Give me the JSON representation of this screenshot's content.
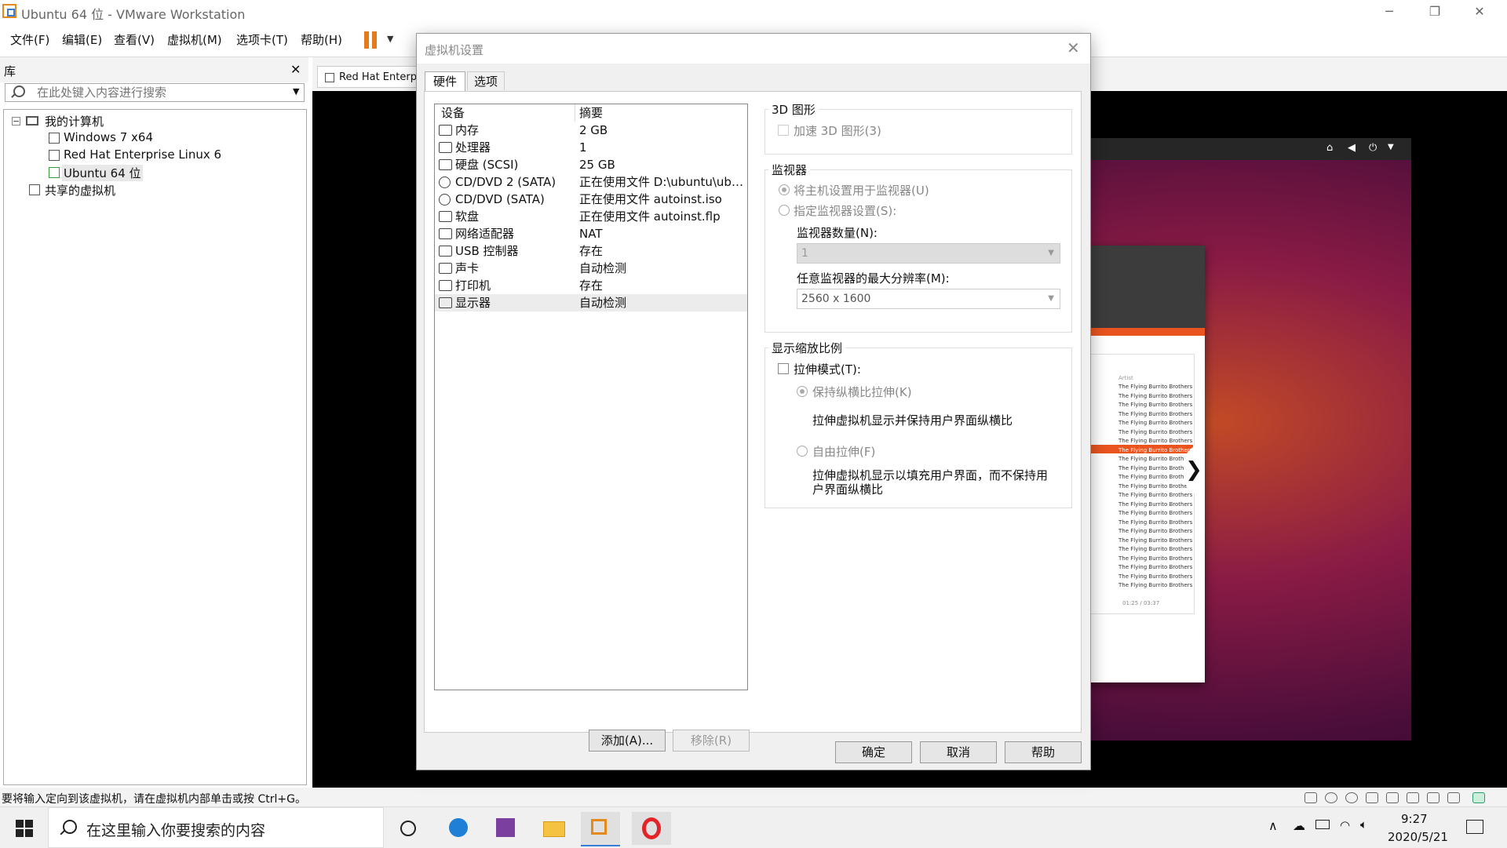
{
  "window": {
    "title": "Ubuntu 64 位 - VMware Workstation",
    "controls": [
      "─",
      "❐",
      "✕"
    ]
  },
  "menu": [
    "文件(F)",
    "编辑(E)",
    "查看(V)",
    "虚拟机(M)",
    "选项卡(T)",
    "帮助(H)"
  ],
  "library": {
    "title": "库",
    "close": "✕",
    "search_placeholder": "在此处键入内容进行搜索",
    "tree": {
      "expander": "−",
      "root": "我的计算机",
      "vms": [
        "Windows 7 x64",
        "Red Hat Enterprise Linux 6",
        "Ubuntu 64 位"
      ],
      "shared": "共享的虚拟机"
    }
  },
  "vm_tab": {
    "label": "Red Hat Enterpris"
  },
  "guest": {
    "song_artist_header": "Artist",
    "song_artist": "The Flying Burrito Brothers",
    "player_time": "01:25 / 03:37",
    "side_arrow": "❯"
  },
  "dialog": {
    "title": "虚拟机设置",
    "close": "✕",
    "tabs": [
      "硬件",
      "选项"
    ],
    "device_header": {
      "device": "设备",
      "summary": "摘要"
    },
    "devices": [
      {
        "name": "内存",
        "summary": "2 GB",
        "icon": "memory-icon"
      },
      {
        "name": "处理器",
        "summary": "1",
        "icon": "processor-icon"
      },
      {
        "name": "硬盘 (SCSI)",
        "summary": "25 GB",
        "icon": "harddisk-icon"
      },
      {
        "name": "CD/DVD 2 (SATA)",
        "summary": "正在使用文件 D:\\ubuntu\\ubu...",
        "icon": "cd-dvd-icon"
      },
      {
        "name": "CD/DVD (SATA)",
        "summary": "正在使用文件 autoinst.iso",
        "icon": "cd-dvd-icon"
      },
      {
        "name": "软盘",
        "summary": "正在使用文件 autoinst.flp",
        "icon": "floppy-icon"
      },
      {
        "name": "网络适配器",
        "summary": "NAT",
        "icon": "network-icon"
      },
      {
        "name": "USB 控制器",
        "summary": "存在",
        "icon": "usb-icon"
      },
      {
        "name": "声卡",
        "summary": "自动检测",
        "icon": "speaker-icon"
      },
      {
        "name": "打印机",
        "summary": "存在",
        "icon": "printer-icon"
      },
      {
        "name": "显示器",
        "summary": "自动检测",
        "icon": "display-icon"
      }
    ],
    "add_button": "添加(A)...",
    "remove_button": "移除(R)",
    "graphics": {
      "title": "3D 图形",
      "accelerate": "加速 3D 图形(3)"
    },
    "monitor": {
      "title": "监视器",
      "use_host": "将主机设置用于监视器(U)",
      "specify": "指定监视器设置(S):",
      "count_label": "监视器数量(N):",
      "count_value": "1",
      "maxres_label": "任意监视器的最大分辨率(M):",
      "maxres_value": "2560 x 1600"
    },
    "scaling": {
      "title": "显示缩放比例",
      "stretch": "拉伸模式(T):",
      "keep_aspect": "保持纵横比拉伸(K)",
      "keep_aspect_desc": "拉伸虚拟机显示并保持用户界面纵横比",
      "free": "自由拉伸(F)",
      "free_desc_1": "拉伸虚拟机显示以填充用户界面，而不保持用",
      "free_desc_2": "户界面纵横比"
    },
    "ok": "确定",
    "cancel": "取消",
    "help": "帮助"
  },
  "statusbar": {
    "text": "要将输入定向到该虚拟机，请在虚拟机内部单击或按 Ctrl+G。"
  },
  "taskbar": {
    "search": "在这里输入你要搜索的内容",
    "time": "9:27",
    "date": "2020/5/21"
  }
}
